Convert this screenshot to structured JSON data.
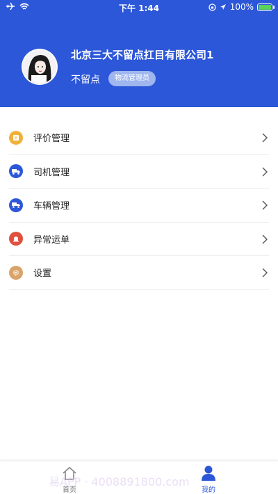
{
  "status_bar": {
    "time": "下午 1:44",
    "battery": "100%"
  },
  "profile": {
    "company": "北京三大不留点扛目有限公司1",
    "username": "不留点",
    "role_badge": "物流管理员"
  },
  "menu": [
    {
      "label": "评价管理",
      "icon": "edit-icon",
      "color": "#f0b13a"
    },
    {
      "label": "司机管理",
      "icon": "truck-icon",
      "color": "#2c57d9"
    },
    {
      "label": "车辆管理",
      "icon": "truck-icon",
      "color": "#2c57d9"
    },
    {
      "label": "异常运单",
      "icon": "alarm-icon",
      "color": "#e0503f"
    },
    {
      "label": "设置",
      "icon": "gear-icon",
      "color": "#d9a46a"
    }
  ],
  "tabs": {
    "home": "首页",
    "mine": "我的"
  },
  "watermark": "易APP · 4008891800.com",
  "colors": {
    "primary": "#2c57d9",
    "badge": "#9fb6ee"
  }
}
